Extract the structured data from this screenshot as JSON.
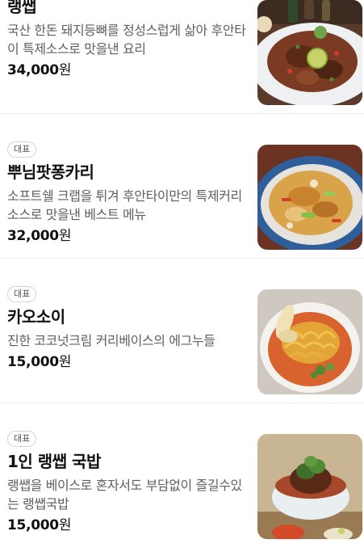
{
  "menu": [
    {
      "badge": "",
      "name": "랭쌥",
      "desc": "국산 한돈 돼지등뼈를 정성스럽게 삶아 후안타이 특제소스로 맛을낸 요리",
      "price": "34,000",
      "currency": "원",
      "image": "spicy-pork-bone-dish"
    },
    {
      "badge": "대표",
      "name": "뿌님팟퐁카리",
      "desc": "소프트쉘 크랩을 튀겨 후안타이만의 특제커리소스로 맛을낸 베스트 메뉴",
      "price": "32,000",
      "currency": "원",
      "image": "crab-curry-dish"
    },
    {
      "badge": "대표",
      "name": "카오소이",
      "desc": "진한 코코넛크림 커리베이스의 에그누들",
      "price": "15,000",
      "currency": "원",
      "image": "khao-soi-bowl"
    },
    {
      "badge": "대표",
      "name": "1인 랭쌥 국밥",
      "desc": "랭쌥을 베이스로 혼자서도 부담없이 즐길수있는 랭쌥국밥",
      "price": "15,000",
      "currency": "원",
      "image": "pork-bone-soup-bowl"
    }
  ]
}
